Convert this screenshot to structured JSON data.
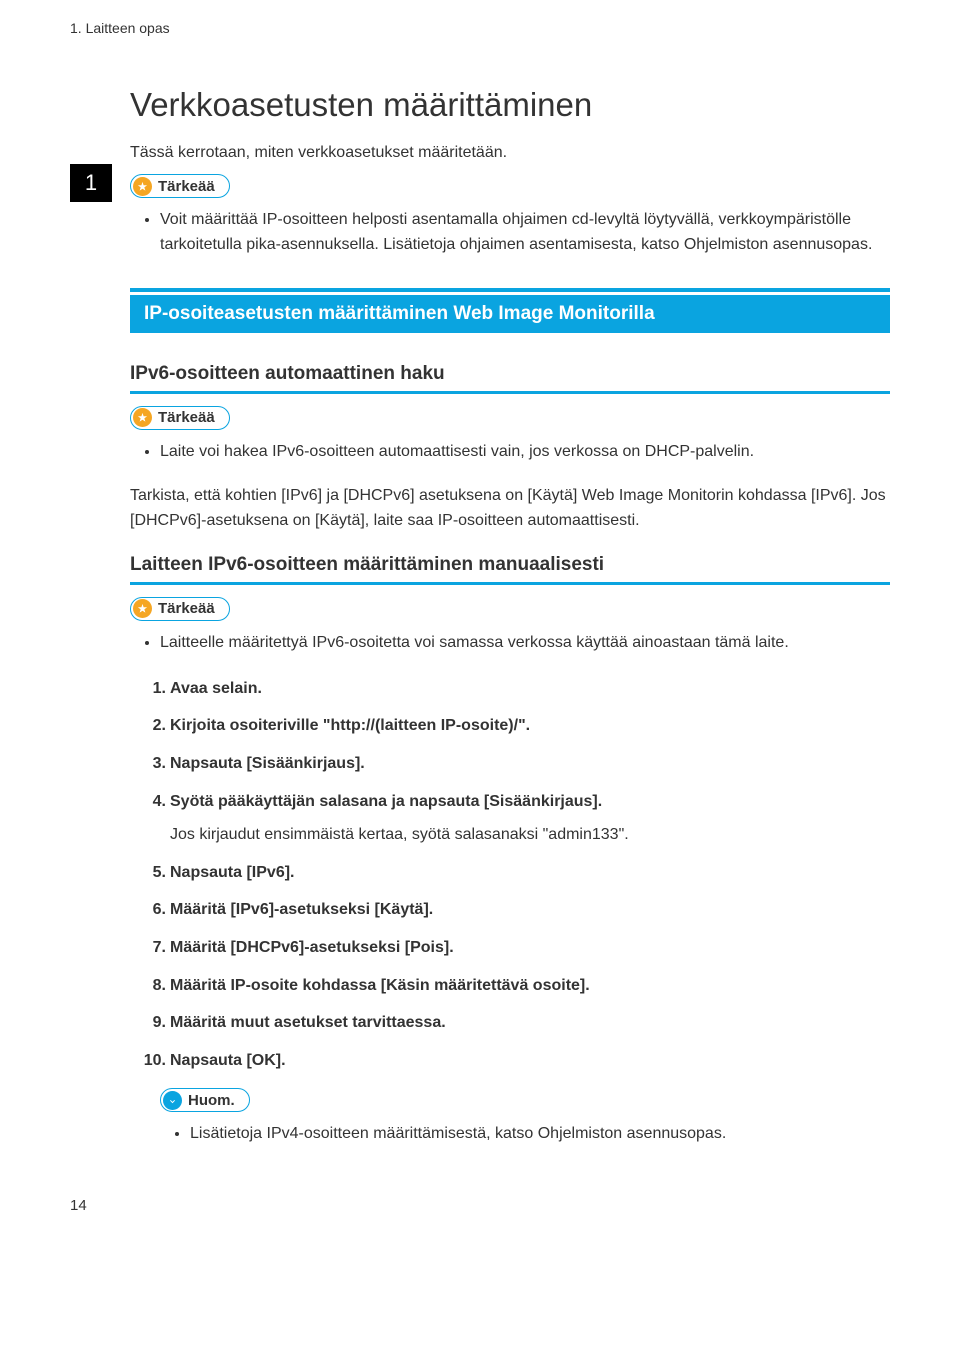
{
  "header": {
    "breadcrumb": "1. Laitteen opas"
  },
  "chapterNumber": "1",
  "title": "Verkkoasetusten määrittäminen",
  "intro": "Tässä kerrotaan, miten verkkoasetukset määritetään.",
  "badges": {
    "important": "Tärkeää",
    "note": "Huom."
  },
  "topImportant": {
    "bullet1": "Voit määrittää IP-osoitteen helposti asentamalla ohjaimen cd-levyltä löytyvällä, verkkoympäristölle tarkoitetulla pika-asennuksella. Lisätietoja ohjaimen asentamisesta, katso Ohjelmiston asennusopas."
  },
  "sectionBar": "IP-osoiteasetusten määrittäminen Web Image Monitorilla",
  "sub1": {
    "heading": "IPv6-osoitteen automaattinen haku",
    "bullet1": "Laite voi hakea IPv6-osoitteen automaattisesti vain, jos verkossa on DHCP-palvelin.",
    "para1": "Tarkista, että kohtien [IPv6] ja [DHCPv6] asetuksena on [Käytä] Web Image Monitorin kohdassa [IPv6]. Jos [DHCPv6]-asetuksena on [Käytä], laite saa IP-osoitteen automaattisesti."
  },
  "sub2": {
    "heading": "Laitteen IPv6-osoitteen määrittäminen manuaalisesti",
    "bullet1": "Laitteelle määritettyä IPv6-osoitetta voi samassa verkossa käyttää ainoastaan tämä laite.",
    "steps": [
      {
        "text": "Avaa selain."
      },
      {
        "text": "Kirjoita osoiteriville \"http://(laitteen IP-osoite)/\"."
      },
      {
        "text": "Napsauta [Sisäänkirjaus]."
      },
      {
        "text": "Syötä pääkäyttäjän salasana ja napsauta [Sisäänkirjaus].",
        "sub": "Jos kirjaudut ensimmäistä kertaa, syötä salasanaksi \"admin133\"."
      },
      {
        "text": "Napsauta [IPv6]."
      },
      {
        "text": "Määritä [IPv6]-asetukseksi [Käytä]."
      },
      {
        "text": "Määritä [DHCPv6]-asetukseksi [Pois]."
      },
      {
        "text": "Määritä IP-osoite kohdassa [Käsin määritettävä osoite]."
      },
      {
        "text": "Määritä muut asetukset tarvittaessa."
      },
      {
        "text": "Napsauta [OK]."
      }
    ],
    "noteBullet": "Lisätietoja IPv4-osoitteen määrittämisestä, katso Ohjelmiston asennusopas."
  },
  "pageNumber": "14"
}
